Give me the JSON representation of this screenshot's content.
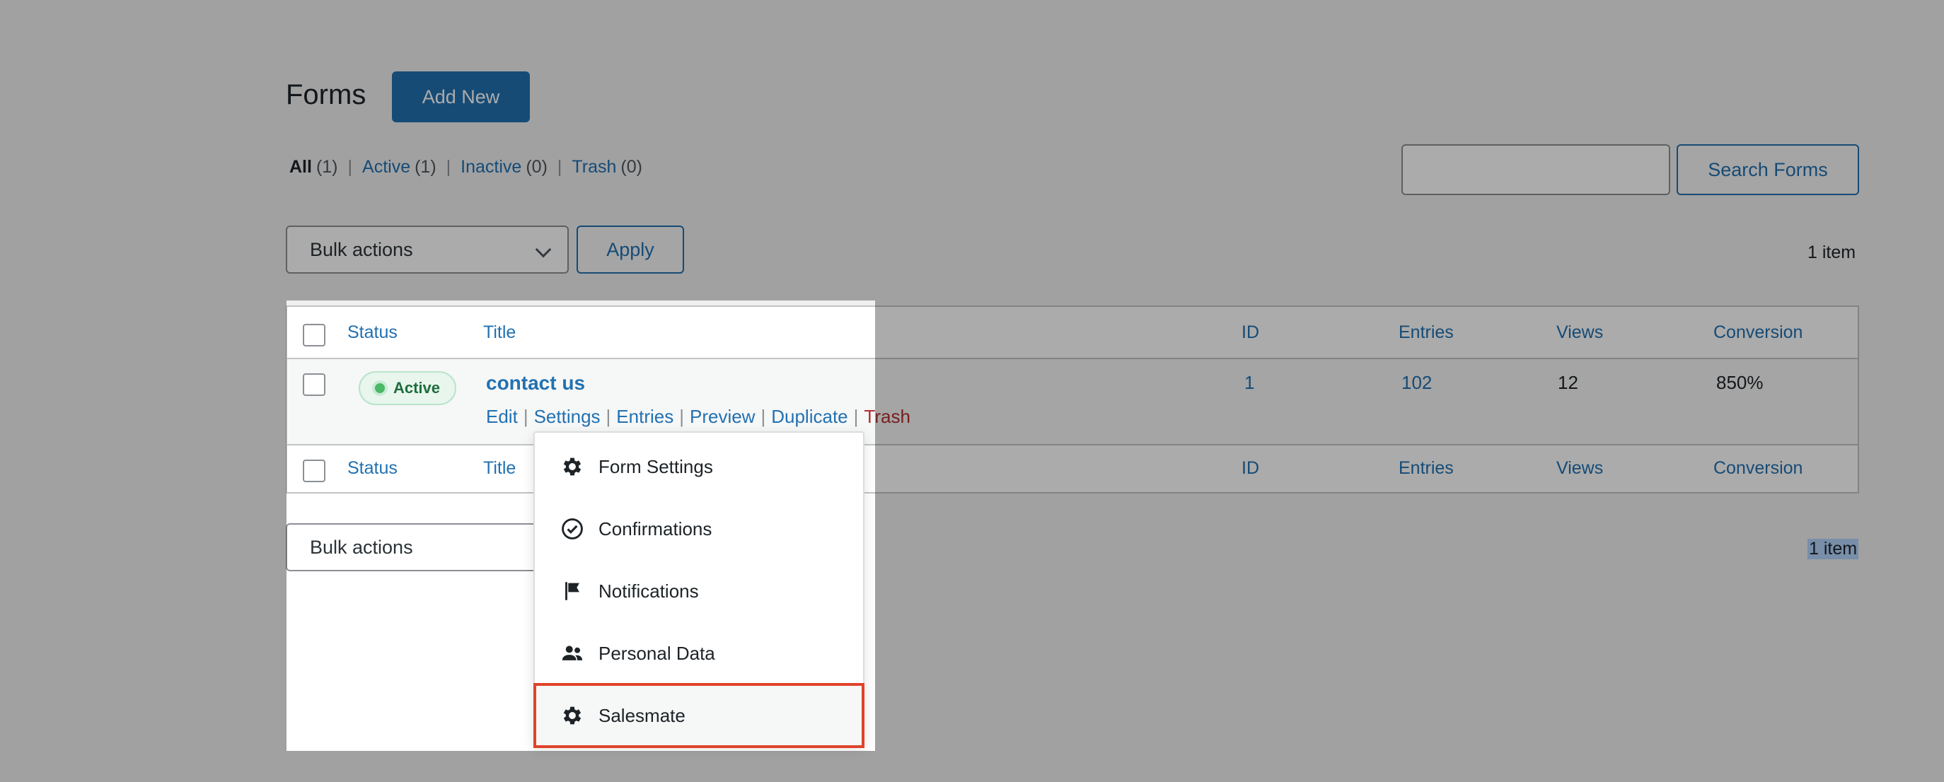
{
  "header": {
    "title": "Forms",
    "add_new": "Add New"
  },
  "filters": {
    "all_label": "All",
    "all_count": "(1)",
    "active_label": "Active",
    "active_count": "(1)",
    "inactive_label": "Inactive",
    "inactive_count": "(0)",
    "trash_label": "Trash",
    "trash_count": "(0)",
    "separator": "|"
  },
  "search": {
    "value": "",
    "placeholder": "",
    "button": "Search Forms"
  },
  "bulk": {
    "select_value": "Bulk actions",
    "apply": "Apply",
    "count": "1 item"
  },
  "table": {
    "columns": [
      "Status",
      "Title",
      "ID",
      "Entries",
      "Views",
      "Conversion"
    ],
    "row": {
      "status": "Active",
      "title": "contact us",
      "id": "1",
      "entries": "102",
      "views": "12",
      "conversion": "850%",
      "actions": [
        "Edit",
        "Settings",
        "Entries",
        "Preview",
        "Duplicate",
        "Trash"
      ]
    }
  },
  "bottom_bulk": {
    "select_value": "Bulk actions",
    "count": "1 item"
  },
  "menu": {
    "items": [
      {
        "label": "Form Settings",
        "icon": "gear-icon"
      },
      {
        "label": "Confirmations",
        "icon": "check-circle-icon"
      },
      {
        "label": "Notifications",
        "icon": "flag-icon"
      },
      {
        "label": "Personal Data",
        "icon": "people-icon"
      },
      {
        "label": "Salesmate",
        "icon": "gear-icon"
      }
    ],
    "highlight_color": "#e0432b"
  }
}
